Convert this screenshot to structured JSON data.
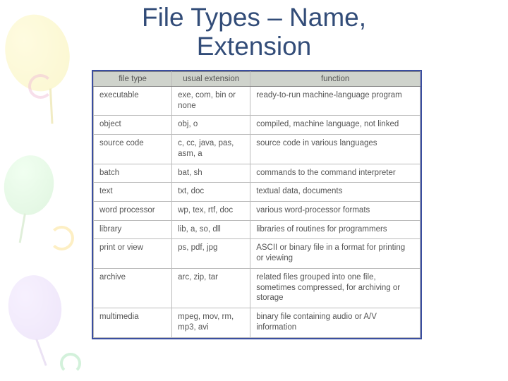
{
  "title_line1": "File Types – Name,",
  "title_line2": "Extension",
  "headers": {
    "c1": "file type",
    "c2": "usual extension",
    "c3": "function"
  },
  "rows": [
    {
      "c1": "executable",
      "c2": "exe, com, bin or none",
      "c3": "ready-to-run machine-language program"
    },
    {
      "c1": "object",
      "c2": "obj, o",
      "c3": "compiled, machine language, not linked"
    },
    {
      "c1": "source code",
      "c2": "c, cc, java, pas, asm, a",
      "c3": "source code in various languages"
    },
    {
      "c1": "batch",
      "c2": "bat, sh",
      "c3": "commands to the command interpreter"
    },
    {
      "c1": "text",
      "c2": "txt, doc",
      "c3": "textual data, documents"
    },
    {
      "c1": "word processor",
      "c2": "wp, tex, rtf, doc",
      "c3": "various word-processor formats"
    },
    {
      "c1": "library",
      "c2": "lib, a, so, dll",
      "c3": "libraries of routines for programmers"
    },
    {
      "c1": "print or view",
      "c2": "ps, pdf, jpg",
      "c3": "ASCII or binary file in a format for printing or viewing"
    },
    {
      "c1": "archive",
      "c2": "arc, zip, tar",
      "c3": "related files grouped into one file, sometimes compressed, for archiving or storage"
    },
    {
      "c1": "multimedia",
      "c2": "mpeg, mov, rm, mp3, avi",
      "c3": "binary file containing audio or A/V information"
    }
  ],
  "chart_data": {
    "type": "table",
    "title": "File Types – Name, Extension",
    "columns": [
      "file type",
      "usual extension",
      "function"
    ],
    "rows": [
      [
        "executable",
        "exe, com, bin or none",
        "ready-to-run machine-language program"
      ],
      [
        "object",
        "obj, o",
        "compiled, machine language, not linked"
      ],
      [
        "source code",
        "c, cc, java, pas, asm, a",
        "source code in various languages"
      ],
      [
        "batch",
        "bat, sh",
        "commands to the command interpreter"
      ],
      [
        "text",
        "txt, doc",
        "textual data, documents"
      ],
      [
        "word processor",
        "wp, tex, rtf, doc",
        "various word-processor formats"
      ],
      [
        "library",
        "lib, a, so, dll",
        "libraries of routines for programmers"
      ],
      [
        "print or view",
        "ps, pdf, jpg",
        "ASCII or binary file in a format for printing or viewing"
      ],
      [
        "archive",
        "arc, zip, tar",
        "related files grouped into one file, sometimes compressed, for archiving or storage"
      ],
      [
        "multimedia",
        "mpeg, mov, rm, mp3, avi",
        "binary file containing audio or A/V information"
      ]
    ]
  }
}
